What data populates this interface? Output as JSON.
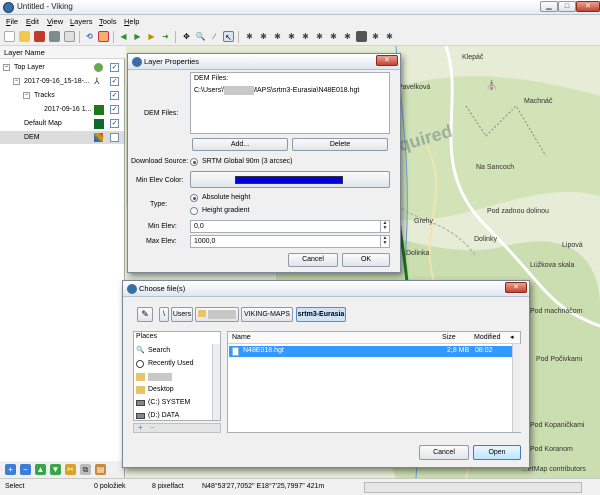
{
  "window": {
    "title": "Untitled - Viking",
    "minimize": "▁",
    "maximize": "□",
    "close": "✕"
  },
  "menu": [
    "File",
    "Edit",
    "View",
    "Layers",
    "Tools",
    "Help"
  ],
  "toolbar_icons": [
    "new-icon",
    "open-icon",
    "save-icon",
    "print-icon",
    "close-icon",
    "undo-icon",
    "mode-icon",
    "back-icon",
    "forward-icon",
    "up-icon",
    "add-icon",
    "pan-icon",
    "zoom-icon",
    "ruler-icon",
    "select-icon",
    "create-track-icon",
    "create-route-icon",
    "create-waypoint-icon",
    "edit-trackpoint-icon",
    "edit-waypoint-icon",
    "dem-download-icon",
    "map-download-icon",
    "georef-icon",
    "route-finder-icon",
    "mapnik-icon",
    "srtm-icon"
  ],
  "layer_panel": {
    "header": "Layer Name",
    "layers": [
      {
        "name": "Top Layer",
        "expanded": "−",
        "checked": "✓"
      },
      {
        "name": "2017-09-16_15-18-...",
        "expanded": "−",
        "checked": "✓"
      },
      {
        "name": "Tracks",
        "expanded": "−",
        "checked": "✓"
      },
      {
        "name": "2017-09-16 1...",
        "checked": "✓"
      },
      {
        "name": "Default Map",
        "checked": "✓"
      },
      {
        "name": "DEM",
        "checked": ""
      }
    ]
  },
  "map": {
    "labels": [
      "Klepáč",
      "Pavelková",
      "Machnáč",
      "Na Sancoch",
      "Pod zadnou dolinou",
      "Grehy",
      "Dolinky",
      "Lipová",
      "Dolinka",
      "Lúžkova skala",
      "Pod machnáčom",
      "Pod Počivkami",
      "Pod Kopaničkami",
      "Pod Koranom",
      "...etMap contributors",
      "quired"
    ]
  },
  "layer_properties": {
    "title": "Layer Properties",
    "dem_files_label": "DEM Files:",
    "dem_files_header": "DEM Files:",
    "dem_file_path": "C:\\Users\\\\VIKING-MAPS\\srtm3-Eurasia\\N48E018.hgt",
    "add_button": "Add...",
    "delete_button": "Delete",
    "download_source_label": "Download Source:",
    "download_source_value": "SRTM Global 90m (3 arcsec)",
    "min_elev_color_label": "Min Elev Color:",
    "min_elev_color": "#0000e0",
    "type_label": "Type:",
    "type_absolute": "Absolute height",
    "type_gradient": "Height gradient",
    "min_elev_label": "Min Elev:",
    "min_elev_value": "0,0",
    "max_elev_label": "Max Elev:",
    "max_elev_value": "1000,0",
    "cancel_button": "Cancel",
    "ok_button": "OK"
  },
  "choose_file": {
    "title": "Choose file(s)",
    "path_segments": [
      "\\",
      "Users",
      "",
      "VIKING-MAPS",
      "srtm3-Eurasia"
    ],
    "places_header": "Places",
    "places": [
      "Search",
      "Recently Used",
      "",
      "Desktop",
      "(C:) SYSTEM",
      "(D:) DATA"
    ],
    "columns": {
      "name": "Name",
      "size": "Size",
      "modified": "Modified"
    },
    "sort_indicator": "◂",
    "files": [
      {
        "name": "N48E018.hgt",
        "size": "2,8 MB",
        "modified": "08:02"
      }
    ],
    "add_place": "+",
    "remove_place": "−",
    "cancel_button": "Cancel",
    "open_button": "Open"
  },
  "status_bar": {
    "left": "Select",
    "items": "0 položiek",
    "zoom": "8 pixelfact",
    "coords": "N48°53'27,7052\" E18°7'25,7997\" 421m"
  },
  "colors": {
    "accent": "#3399ff",
    "dem_color": "#0000e0",
    "title_blue": "#3b6ea5"
  }
}
